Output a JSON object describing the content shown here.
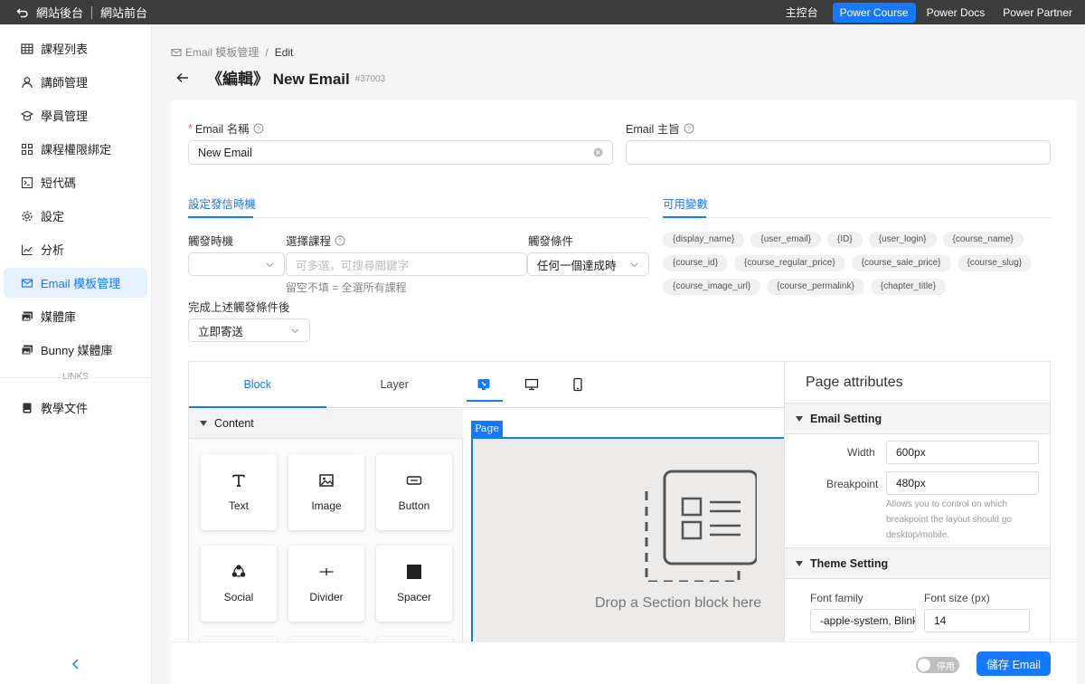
{
  "topbar": {
    "left": {
      "back_label": "網站後台",
      "front_label": "網站前台"
    },
    "links": [
      "主控台",
      "Power Course",
      "Power Docs",
      "Power Partner"
    ]
  },
  "sidebar": {
    "items": [
      {
        "label": "課程列表",
        "icon": "table-icon"
      },
      {
        "label": "講師管理",
        "icon": "user-icon"
      },
      {
        "label": "學員管理",
        "icon": "student-icon"
      },
      {
        "label": "課程權限綁定",
        "icon": "grid-icon"
      },
      {
        "label": "短代碼",
        "icon": "code-icon"
      },
      {
        "label": "設定",
        "icon": "gear-icon"
      },
      {
        "label": "分析",
        "icon": "chart-icon"
      },
      {
        "label": "Email 模板管理",
        "icon": "mail-icon",
        "active": true
      },
      {
        "label": "媒體庫",
        "icon": "media-icon"
      },
      {
        "label": "Bunny 媒體庫",
        "icon": "media-icon"
      }
    ],
    "links_label": "LINKS",
    "links": [
      {
        "label": "教學文件",
        "icon": "book-icon"
      }
    ]
  },
  "breadcrumb": {
    "parent": "Email 模板管理",
    "current": "Edit"
  },
  "page": {
    "title": "《編輯》 New Email",
    "id": "#37003"
  },
  "form": {
    "email_name_label": "Email 名稱",
    "email_name_value": "New Email",
    "subject_label": "Email 主旨",
    "subject_value": "",
    "trigger_section": "設定發信時機",
    "variables_section": "可用變數",
    "trigger_time_label": "觸發時機",
    "course_label": "選擇課程",
    "course_placeholder": "可多選，可搜尋關鍵字",
    "course_hint": "留空不填 = 全選所有課程",
    "condition_label": "觸發條件",
    "condition_value": "任何一個達成時",
    "after_label": "完成上述觸發條件後",
    "after_value": "立即寄送"
  },
  "variables": [
    "{display_name}",
    "{user_email}",
    "{ID}",
    "{user_login}",
    "{course_name}",
    "{course_id}",
    "{course_regular_price}",
    "{course_sale_price}",
    "{course_slug}",
    "{course_image_url}",
    "{course_permalink}",
    "{chapter_title}"
  ],
  "editor": {
    "tabs": [
      "Block",
      "Layer"
    ],
    "group": "Content",
    "blocks": [
      {
        "label": "Text",
        "icon": "text-icon"
      },
      {
        "label": "Image",
        "icon": "image-icon"
      },
      {
        "label": "Button",
        "icon": "button-icon"
      },
      {
        "label": "Social",
        "icon": "social-icon"
      },
      {
        "label": "Divider",
        "icon": "divider-icon"
      },
      {
        "label": "Spacer",
        "icon": "spacer-icon"
      }
    ],
    "page_tag": "Page",
    "drop_text": "Drop a Section block here",
    "attributes": {
      "title": "Page attributes",
      "email_setting": "Email Setting",
      "width_label": "Width",
      "width_value": "600px",
      "breakpoint_label": "Breakpoint",
      "breakpoint_value": "480px",
      "breakpoint_hint": "Allows you to control on which breakpoint the layout should go desktop/mobile.",
      "theme_setting": "Theme Setting",
      "font_family_label": "Font family",
      "font_family_value": "-apple-system, BlinkMacSystemFont",
      "font_size_label": "Font size (px)",
      "font_size_value": "14"
    }
  },
  "footer": {
    "toggle_label": "停用",
    "save_label": "儲存 Email"
  }
}
